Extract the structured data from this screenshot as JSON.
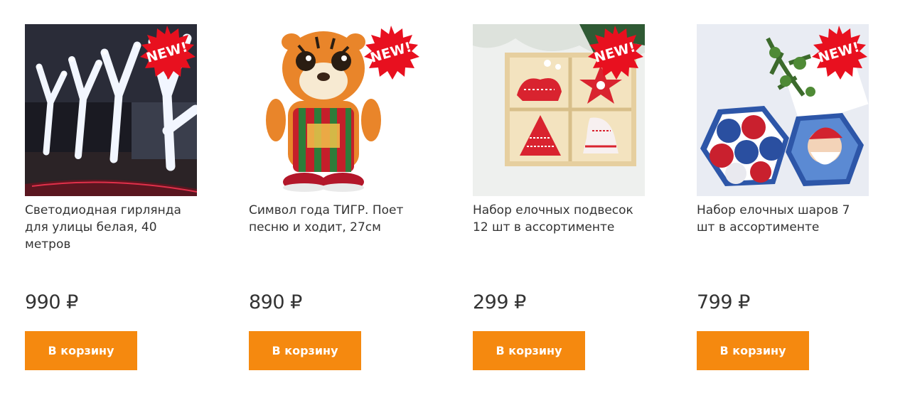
{
  "products": [
    {
      "title": "Светодиодная гирлянда для улицы белая, 40 метров",
      "price": "990 ₽",
      "badge": "NEW!",
      "button_label": "В корзину",
      "image_icon": "garland-photo"
    },
    {
      "title": "Символ года ТИГР. Поет песню и ходит, 27см",
      "price": "890 ₽",
      "badge": "NEW!",
      "button_label": "В корзину",
      "image_icon": "tiger-toy-photo"
    },
    {
      "title": "Набор елочных подвесок 12 шт в ассортименте",
      "price": "299 ₽",
      "badge": "NEW!",
      "button_label": "В корзину",
      "image_icon": "ornaments-box-photo"
    },
    {
      "title": "Набор елочных шаров 7 шт в ассортименте",
      "price": "799 ₽",
      "badge": "NEW!",
      "button_label": "В корзину",
      "image_icon": "baubles-box-photo"
    }
  ],
  "colors": {
    "button": "#f5890f",
    "badge": "#e8101f",
    "text": "#333333"
  }
}
